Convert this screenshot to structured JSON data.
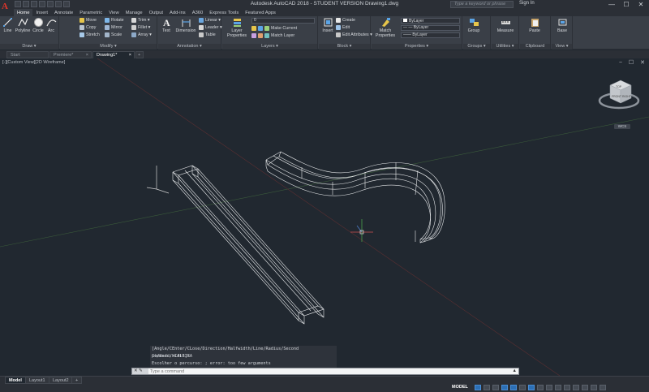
{
  "window": {
    "title": "Autodesk AutoCAD 2018 - STUDENT VERSION    Drawing1.dwg",
    "search_placeholder": "Type a keyword or phrase",
    "sign_in": "Sign In",
    "min": "—",
    "max": "☐",
    "close": "✕"
  },
  "ribbon_tabs": [
    "Home",
    "Insert",
    "Annotate",
    "Parametric",
    "View",
    "Manage",
    "Output",
    "Add-ins",
    "A360",
    "Express Tools",
    "Featured Apps"
  ],
  "ribbon": {
    "draw": {
      "label": "Draw",
      "line": "Line",
      "polyline": "Polyline",
      "circle": "Circle",
      "arc": "Arc"
    },
    "modify": {
      "label": "Modify",
      "move": "Move",
      "rotate": "Rotate",
      "trim": "Trim",
      "copy": "Copy",
      "mirror": "Mirror",
      "fillet": "Fillet",
      "stretch": "Stretch",
      "scale": "Scale",
      "array": "Array"
    },
    "annotation": {
      "label": "Annotation",
      "text": "Text",
      "dimension": "Dimension",
      "linear": "Linear",
      "leader": "Leader",
      "table": "Table"
    },
    "layers": {
      "label": "Layers",
      "layer_properties": "Layer Properties",
      "current_layer": "0",
      "make_current": "Make Current",
      "match_layer": "Match Layer"
    },
    "block": {
      "label": "Block",
      "insert": "Insert",
      "create": "Create",
      "edit": "Edit",
      "edit_attributes": "Edit Attributes"
    },
    "properties": {
      "label": "Properties",
      "match_properties": "Match Properties",
      "color": "ByLayer",
      "linetype": "ByLayer",
      "lineweight": "ByLayer"
    },
    "groups": {
      "label": "Groups",
      "group": "Group"
    },
    "utilities": {
      "label": "Utilities",
      "measure": "Measure"
    },
    "clipboard": {
      "label": "Clipboard",
      "paste": "Paste"
    },
    "view": {
      "label": "View",
      "base": "Base"
    }
  },
  "file_tabs": [
    {
      "label": "Start"
    },
    {
      "label": "Premiere*"
    },
    {
      "label": "Drawing1*"
    }
  ],
  "viewport": {
    "label": "[-][Custom View][2D Wireframe]",
    "controls": "− ☐ ✕",
    "viewcube_face_top": "TOP",
    "viewcube_face_front": "FRONT",
    "viewcube_face_right": "RIGHT",
    "wcs": "WCS"
  },
  "command": {
    "history": [
      "[Angle/CEnter/CLose/Direction/Halfwidth/Line/Radius/Second pt/Undo/Width]:",
      "Command: CALEIRA",
      " Escolher o percurso: ; error: too few arguments"
    ],
    "placeholder": "Type a command",
    "prompt_icons": "✕ ✎"
  },
  "layout_tabs": [
    "Model",
    "Layout1",
    "Layout2"
  ],
  "status": {
    "model": "MODEL",
    "add_tab": "+"
  },
  "colors": {
    "accent": "#2c6fb5",
    "viewport_bg": "#212830",
    "ribbon_bg": "#3a3f47",
    "app_logo": "#e0352a"
  }
}
